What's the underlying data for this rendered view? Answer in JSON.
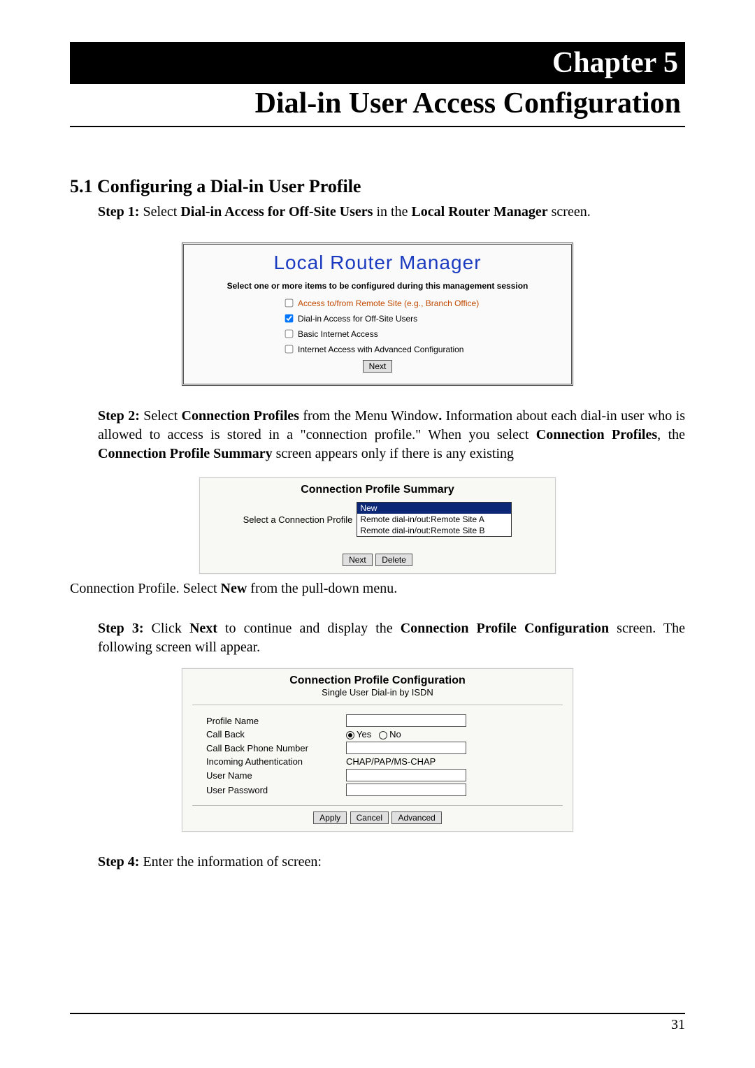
{
  "chapter": {
    "banner": "Chapter 5",
    "title": "Dial-in User Access Configuration"
  },
  "section": {
    "heading": "5.1 Configuring a Dial-in User Profile",
    "step1_lead": "Step 1: ",
    "step1_select": "Select ",
    "step1_link": "Dial-in Access for Off-Site Users",
    "step1_mid": " in the ",
    "step1_mgr": "Local Router Manager",
    "step1_end": " screen."
  },
  "fig1": {
    "title": "Local Router Manager",
    "instruct": "Select one or more items to be configured during this management session",
    "opt1": "Access to/from Remote Site (e.g., Branch Office)",
    "opt2": "Dial-in Access for Off-Site Users",
    "opt3": "Basic Internet Access",
    "opt4": "Internet Access with Advanced Configuration",
    "next": "Next"
  },
  "step2": {
    "lead": "Step 2: ",
    "t1": "Select ",
    "b1": "Connection Profiles",
    "t2": " from the Menu Window",
    "b2": ". ",
    "t3": "Information about each dial-in user who is allowed to access is stored in a \"connection profile.\" When you select ",
    "b3": "Connection Profiles",
    "t4": ", the ",
    "b4": "Connection Profile Summary",
    "t5": " screen appears only if there is any existing"
  },
  "fig2": {
    "title": "Connection Profile Summary",
    "label": "Select a Connection Profile",
    "options": [
      "New",
      "Remote dial-in/out:Remote Site A",
      "Remote dial-in/out:Remote Site B"
    ],
    "next": "Next",
    "delete": "Delete"
  },
  "caption2": {
    "t1": "Connection Profile. Select ",
    "b1": "New",
    "t2": " from the pull-down menu."
  },
  "step3": {
    "lead": "Step 3: ",
    "t1": "Click ",
    "b1": "Next",
    "t2": " to continue and display the ",
    "b2": "Connection Profile Configuration",
    "t3": " screen. The following screen will appear."
  },
  "fig3": {
    "title": "Connection Profile Configuration",
    "subtitle": "Single User Dial-in by ISDN",
    "rows": {
      "profile_name": "Profile Name",
      "call_back": "Call Back",
      "yes": "Yes",
      "no": "No",
      "cb_phone": "Call Back Phone Number",
      "inc_auth": "Incoming Authentication",
      "inc_auth_val": "CHAP/PAP/MS-CHAP",
      "user_name": "User Name",
      "user_pw": "User Password"
    },
    "apply": "Apply",
    "cancel": "Cancel",
    "advanced": "Advanced"
  },
  "step4": {
    "lead": "Step 4: ",
    "text": "Enter the information of screen:"
  },
  "page_number": "31"
}
